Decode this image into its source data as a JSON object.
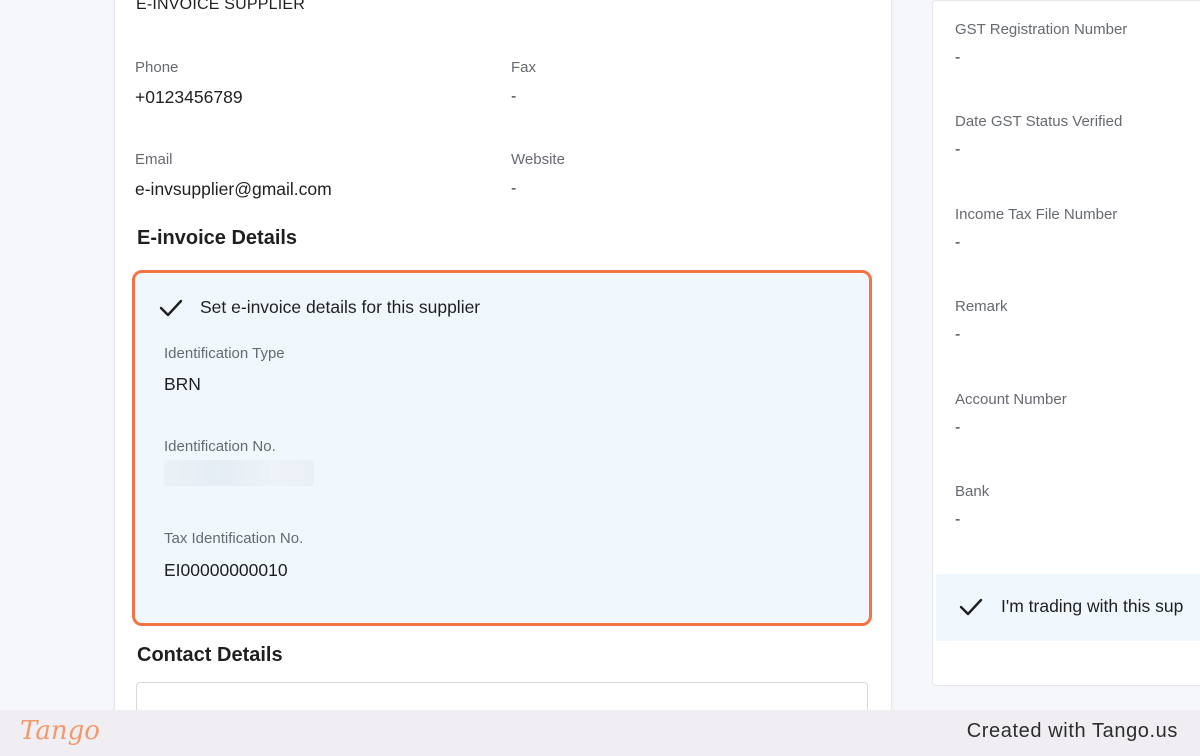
{
  "supplier": {
    "name_partial": "E-INVOICE SUPPLIER",
    "phone": {
      "label": "Phone",
      "value": "+0123456789"
    },
    "fax": {
      "label": "Fax",
      "value": "-"
    },
    "email": {
      "label": "Email",
      "value": "e-invsupplier@gmail.com"
    },
    "website": {
      "label": "Website",
      "value": "-"
    }
  },
  "einvoice": {
    "heading": "E-invoice Details",
    "checkbox_label": "Set e-invoice details for this supplier",
    "checked": true,
    "identification_type": {
      "label": "Identification Type",
      "value": "BRN"
    },
    "identification_no": {
      "label": "Identification No.",
      "value": ""
    },
    "tax_identification_no": {
      "label": "Tax Identification No.",
      "value": "EI00000000010"
    }
  },
  "contact": {
    "heading": "Contact Details"
  },
  "right_panel": {
    "fields": [
      {
        "label": "GST Registration Number",
        "value": "-"
      },
      {
        "label": "Date GST Status Verified",
        "value": "-"
      },
      {
        "label": "Income Tax File Number",
        "value": "-"
      },
      {
        "label": "Remark",
        "value": "-"
      },
      {
        "label": "Account Number",
        "value": "-"
      },
      {
        "label": "Bank",
        "value": "-"
      }
    ],
    "trading_label": "I'm trading with this sup"
  },
  "footer": {
    "logo_text": "Tango",
    "created_text": "Created with Tango.us"
  },
  "colors": {
    "highlight_border": "#f37344",
    "box_bg": "#f1f8fd",
    "logo": "#f19a6b"
  },
  "icons": {
    "check": "check-icon"
  }
}
